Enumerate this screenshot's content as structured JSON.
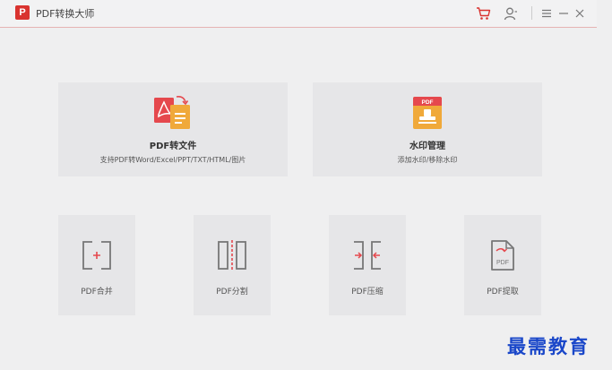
{
  "app": {
    "title": "PDF转换大师",
    "logo_letter": "P"
  },
  "toolbar": {
    "icons": [
      "cart-icon",
      "user-icon",
      "menu-icon",
      "minimize-icon",
      "close-icon"
    ],
    "accent": "#d9332f"
  },
  "features": [
    {
      "title": "PDF转文件",
      "subtitle": "支持PDF转Word/Excel/PPT/TXT/HTML/图片",
      "icon": "pdf-convert-icon"
    },
    {
      "title": "水印管理",
      "subtitle": "添加水印/移除水印",
      "icon": "watermark-stamp-icon"
    }
  ],
  "tools": [
    {
      "label": "PDF合并",
      "icon": "merge-icon"
    },
    {
      "label": "PDF分割",
      "icon": "split-icon"
    },
    {
      "label": "PDF压缩",
      "icon": "compress-icon"
    },
    {
      "label": "PDF提取",
      "icon": "extract-icon"
    }
  ],
  "watermark_badge": {
    "pdf_label": "PDF",
    "extract_label": "PDF"
  },
  "overlay": {
    "text": "最需教育"
  }
}
